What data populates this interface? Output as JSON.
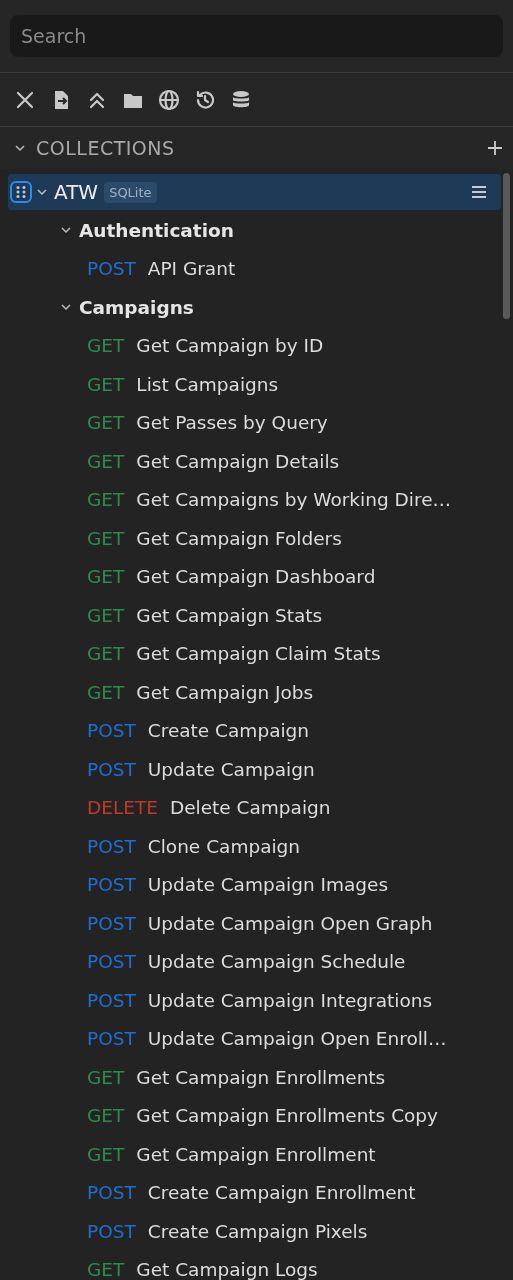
{
  "search": {
    "placeholder": "Search"
  },
  "collections_header": {
    "title": "COLLECTIONS",
    "expanded": true
  },
  "collections": [
    {
      "name": "ATW",
      "badge": "SQLite",
      "selected": true,
      "expanded": true,
      "children": [
        {
          "kind": "folder",
          "name": "Authentication",
          "expanded": true,
          "children": [
            {
              "kind": "request",
              "method": "POST",
              "color": "#1f6fd1",
              "name": "API Grant"
            }
          ]
        },
        {
          "kind": "folder",
          "name": "Campaigns",
          "expanded": true,
          "children": [
            {
              "kind": "request",
              "method": "GET",
              "color": "#2e8b4e",
              "name": "Get Campaign by ID"
            },
            {
              "kind": "request",
              "method": "GET",
              "color": "#2e8b4e",
              "name": "List Campaigns"
            },
            {
              "kind": "request",
              "method": "GET",
              "color": "#2e8b4e",
              "name": "Get Passes by Query"
            },
            {
              "kind": "request",
              "method": "GET",
              "color": "#2e8b4e",
              "name": "Get Campaign Details"
            },
            {
              "kind": "request",
              "method": "GET",
              "color": "#2e8b4e",
              "name": "Get Campaigns by Working Dire…"
            },
            {
              "kind": "request",
              "method": "GET",
              "color": "#2e8b4e",
              "name": "Get Campaign Folders"
            },
            {
              "kind": "request",
              "method": "GET",
              "color": "#2e8b4e",
              "name": "Get Campaign Dashboard"
            },
            {
              "kind": "request",
              "method": "GET",
              "color": "#2e8b4e",
              "name": "Get Campaign Stats"
            },
            {
              "kind": "request",
              "method": "GET",
              "color": "#2e8b4e",
              "name": "Get Campaign Claim Stats"
            },
            {
              "kind": "request",
              "method": "GET",
              "color": "#2e8b4e",
              "name": "Get Campaign Jobs"
            },
            {
              "kind": "request",
              "method": "POST",
              "color": "#1f6fd1",
              "name": "Create Campaign"
            },
            {
              "kind": "request",
              "method": "POST",
              "color": "#1f6fd1",
              "name": "Update Campaign"
            },
            {
              "kind": "request",
              "method": "DELETE",
              "color": "#c0392b",
              "name": "Delete Campaign"
            },
            {
              "kind": "request",
              "method": "POST",
              "color": "#1f6fd1",
              "name": "Clone Campaign"
            },
            {
              "kind": "request",
              "method": "POST",
              "color": "#1f6fd1",
              "name": "Update Campaign Images"
            },
            {
              "kind": "request",
              "method": "POST",
              "color": "#1f6fd1",
              "name": "Update Campaign Open Graph"
            },
            {
              "kind": "request",
              "method": "POST",
              "color": "#1f6fd1",
              "name": "Update Campaign Schedule"
            },
            {
              "kind": "request",
              "method": "POST",
              "color": "#1f6fd1",
              "name": "Update Campaign Integrations"
            },
            {
              "kind": "request",
              "method": "POST",
              "color": "#1f6fd1",
              "name": "Update Campaign Open Enroll…"
            },
            {
              "kind": "request",
              "method": "GET",
              "color": "#2e8b4e",
              "name": "Get Campaign Enrollments"
            },
            {
              "kind": "request",
              "method": "GET",
              "color": "#2e8b4e",
              "name": "Get Campaign Enrollments Copy"
            },
            {
              "kind": "request",
              "method": "GET",
              "color": "#2e8b4e",
              "name": "Get Campaign Enrollment"
            },
            {
              "kind": "request",
              "method": "POST",
              "color": "#1f6fd1",
              "name": "Create Campaign Enrollment"
            },
            {
              "kind": "request",
              "method": "POST",
              "color": "#1f6fd1",
              "name": "Create Campaign Pixels"
            },
            {
              "kind": "request",
              "method": "GET",
              "color": "#2e8b4e",
              "name": "Get Campaign Logs"
            }
          ]
        }
      ]
    }
  ]
}
